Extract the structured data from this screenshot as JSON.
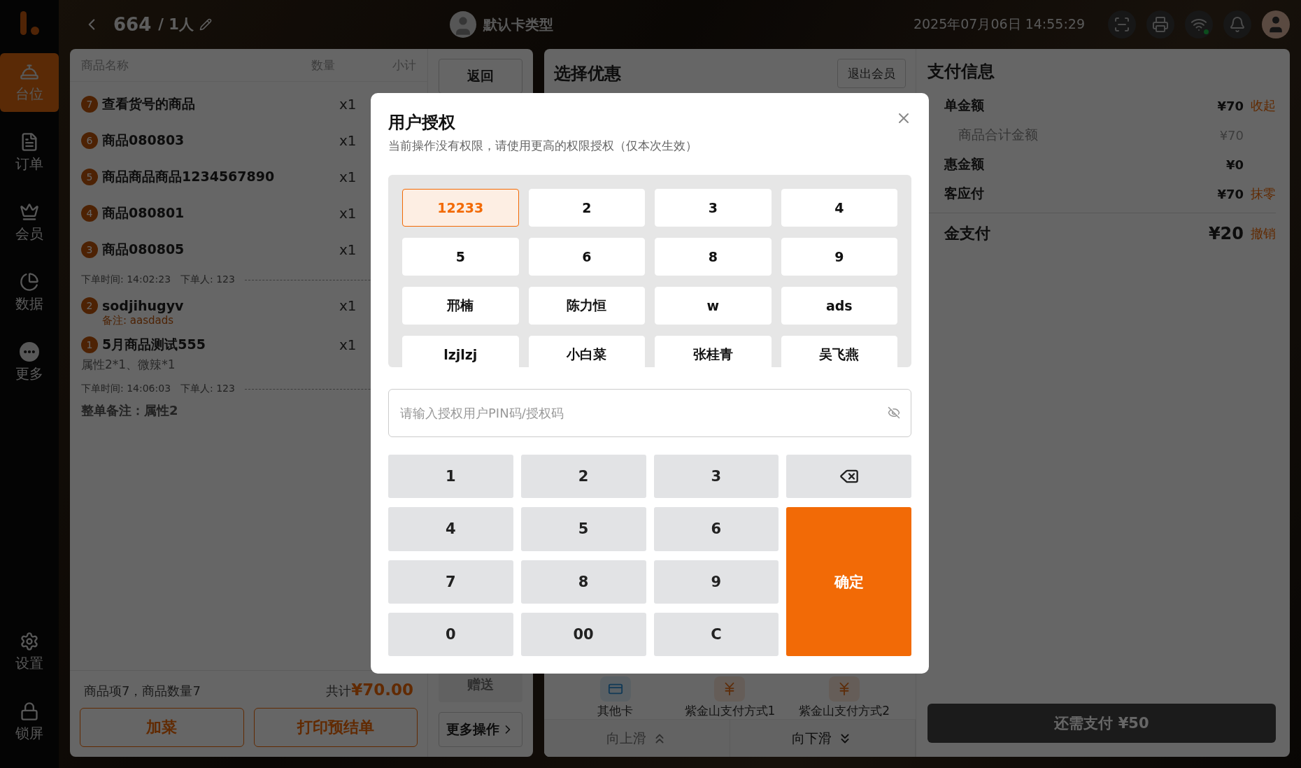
{
  "sidebar": {
    "items": [
      {
        "label": "台位",
        "selected": true
      },
      {
        "label": "订单",
        "selected": false
      },
      {
        "label": "会员",
        "selected": false
      },
      {
        "label": "数据",
        "selected": false
      },
      {
        "label": "更多",
        "selected": false
      }
    ],
    "bottom_items": [
      {
        "label": "设置"
      },
      {
        "label": "锁屏"
      }
    ]
  },
  "header": {
    "table": "664",
    "guests": "/ 1人",
    "card_type": "默认卡类型",
    "datetime": "2025年07月06日 14:55:29"
  },
  "order": {
    "columns": [
      "商品名称",
      "数量",
      "小计"
    ],
    "groups": [
      {
        "items": [
          {
            "index": "7",
            "name": "查看货号的商品",
            "qty": "x1"
          },
          {
            "index": "6",
            "name": "商品080803",
            "qty": "x1"
          },
          {
            "index": "5",
            "name": "商品商品商品1234567890",
            "qty": "x1"
          },
          {
            "index": "4",
            "name": "商品080801",
            "qty": "x1"
          },
          {
            "index": "3",
            "name": "商品080805",
            "qty": "x1"
          }
        ],
        "time": "下单时间: 14:02:23",
        "by": "下单人: 123"
      },
      {
        "items": [
          {
            "index": "2",
            "name": "sodjihugyv",
            "qty": "x1",
            "note": "备注: aasdads"
          },
          {
            "index": "1",
            "name": "5月商品测试555",
            "qty": "x1",
            "attrs": "属性2*1、微辣*1"
          }
        ],
        "time": "下单时间: 14:06:03",
        "by": "下单人: 123"
      }
    ],
    "order_note": "整单备注：属性2",
    "summary": "商品项7，商品数量7",
    "total_label": "共计",
    "total": "¥70.00",
    "buttons": [
      "加菜",
      "打印预结单"
    ]
  },
  "side_actions": {
    "back": "返回",
    "gift": "赠送",
    "more": "更多操作"
  },
  "discounts": {
    "title": "选择优惠",
    "exit_member": "退出会员",
    "payment_methods": [
      {
        "label": "其他卡",
        "kind": "card"
      },
      {
        "label": "紫金山支付方式1",
        "kind": "coin"
      },
      {
        "label": "紫金山支付方式2",
        "kind": "coin"
      }
    ],
    "scroll": [
      {
        "label": "向上滑",
        "kind": "up",
        "disabled": true
      },
      {
        "label": "向下滑",
        "kind": "down",
        "disabled": false
      }
    ]
  },
  "payment": {
    "title": "支付信息",
    "rows": [
      {
        "label": "单金额",
        "amount": "¥70",
        "action": "收起",
        "kind": "main"
      },
      {
        "label": "商品合计金额",
        "amount": "¥70",
        "kind": "sub"
      },
      {
        "label": "惠金额",
        "amount": "¥0",
        "kind": "main"
      },
      {
        "label": "客应付",
        "amount": "¥70",
        "action": "抹零",
        "kind": "main"
      },
      {
        "label": "金支付",
        "amount": "¥20",
        "action": "撤销",
        "kind": "big"
      }
    ],
    "remaining": "还需支付 ¥50"
  },
  "dialog": {
    "title": "用户授权",
    "subtitle": "当前操作没有权限，请使用更高的权限授权（仅本次生效）",
    "users": [
      {
        "name": "12233",
        "selected": true
      },
      {
        "name": "2",
        "selected": false
      },
      {
        "name": "3",
        "selected": false
      },
      {
        "name": "4",
        "selected": false
      },
      {
        "name": "5",
        "selected": false
      },
      {
        "name": "6",
        "selected": false
      },
      {
        "name": "8",
        "selected": false
      },
      {
        "name": "9",
        "selected": false
      },
      {
        "name": "邢楠",
        "selected": false
      },
      {
        "name": "陈力恒",
        "selected": false
      },
      {
        "name": "w",
        "selected": false
      },
      {
        "name": "ads",
        "selected": false
      },
      {
        "name": "lzjlzj",
        "selected": false
      },
      {
        "name": "小白菜",
        "selected": false
      },
      {
        "name": "张桂青",
        "selected": false
      },
      {
        "name": "吴飞燕",
        "selected": false
      }
    ],
    "pin_placeholder": "请输入授权用户PIN码/授权码",
    "keys": [
      {
        "label": "1",
        "kind": "digit"
      },
      {
        "label": "2",
        "kind": "digit"
      },
      {
        "label": "3",
        "kind": "digit"
      },
      {
        "kind": "backspace"
      },
      {
        "label": "4",
        "kind": "digit"
      },
      {
        "label": "5",
        "kind": "digit"
      },
      {
        "label": "6",
        "kind": "digit"
      },
      {
        "label": "7",
        "kind": "digit"
      },
      {
        "label": "8",
        "kind": "digit"
      },
      {
        "label": "9",
        "kind": "digit"
      },
      {
        "label": "确定",
        "kind": "confirm"
      },
      {
        "label": "0",
        "kind": "digit"
      },
      {
        "label": "00",
        "kind": "digit"
      },
      {
        "label": "C",
        "kind": "digit"
      }
    ]
  }
}
